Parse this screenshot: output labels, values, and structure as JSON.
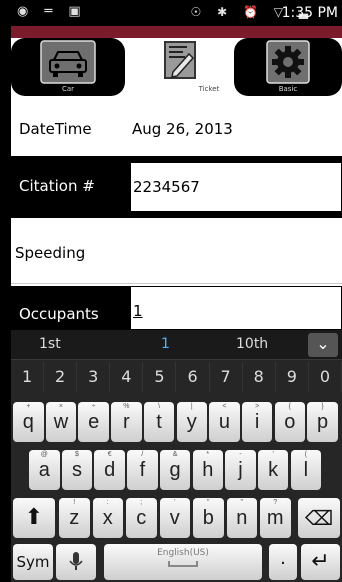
{
  "status": {
    "left_icons": "◉ ═ ▣",
    "right_icons": "☉ ✱ ⏰ ▽ ▃",
    "time": "1:35 PM"
  },
  "tabs": {
    "car_label": "Car",
    "ticket_label": "Ticket",
    "basic_label": "Basic"
  },
  "form": {
    "datetime_label": "DateTime",
    "datetime_value": "Aug 26, 2013",
    "citation_label": "Citation #",
    "citation_value": "2234567",
    "violation_value": "Speeding",
    "occupants_label": "Occupants",
    "occupants_value": "1"
  },
  "keyboard": {
    "suggestions": [
      "1st",
      "1",
      "10th"
    ],
    "collapse_icon": "⌄",
    "numbers": [
      "1",
      "2",
      "3",
      "4",
      "5",
      "6",
      "7",
      "8",
      "9",
      "0"
    ],
    "row1": [
      {
        "k": "q",
        "s": "+"
      },
      {
        "k": "w",
        "s": "×"
      },
      {
        "k": "e",
        "s": "÷"
      },
      {
        "k": "r",
        "s": "%"
      },
      {
        "k": "t",
        "s": "\\"
      },
      {
        "k": "y",
        "s": "|"
      },
      {
        "k": "u",
        "s": "<"
      },
      {
        "k": "i",
        "s": ">"
      },
      {
        "k": "o",
        "s": "{"
      },
      {
        "k": "p",
        "s": "}"
      }
    ],
    "row2": [
      {
        "k": "a",
        "s": "@"
      },
      {
        "k": "s",
        "s": "$"
      },
      {
        "k": "d",
        "s": "€"
      },
      {
        "k": "f",
        "s": "/"
      },
      {
        "k": "g",
        "s": "&"
      },
      {
        "k": "h",
        "s": "*"
      },
      {
        "k": "j",
        "s": "-"
      },
      {
        "k": "k",
        "s": "'"
      },
      {
        "k": "l",
        "s": "("
      }
    ],
    "row3": [
      {
        "k": "z",
        "s": "!"
      },
      {
        "k": "x",
        "s": ":"
      },
      {
        "k": "c",
        "s": ";"
      },
      {
        "k": "v",
        "s": "'"
      },
      {
        "k": "b",
        "s": "\""
      },
      {
        "k": "n",
        "s": "\""
      },
      {
        "k": "m",
        "s": "?"
      }
    ],
    "shift_icon": "⬆",
    "backspace_icon": "⌫",
    "sym_label": "Sym",
    "mic_icon": "🎙",
    "space_label": "English(US)",
    "dots_label": ".",
    "enter_icon": "↵"
  }
}
